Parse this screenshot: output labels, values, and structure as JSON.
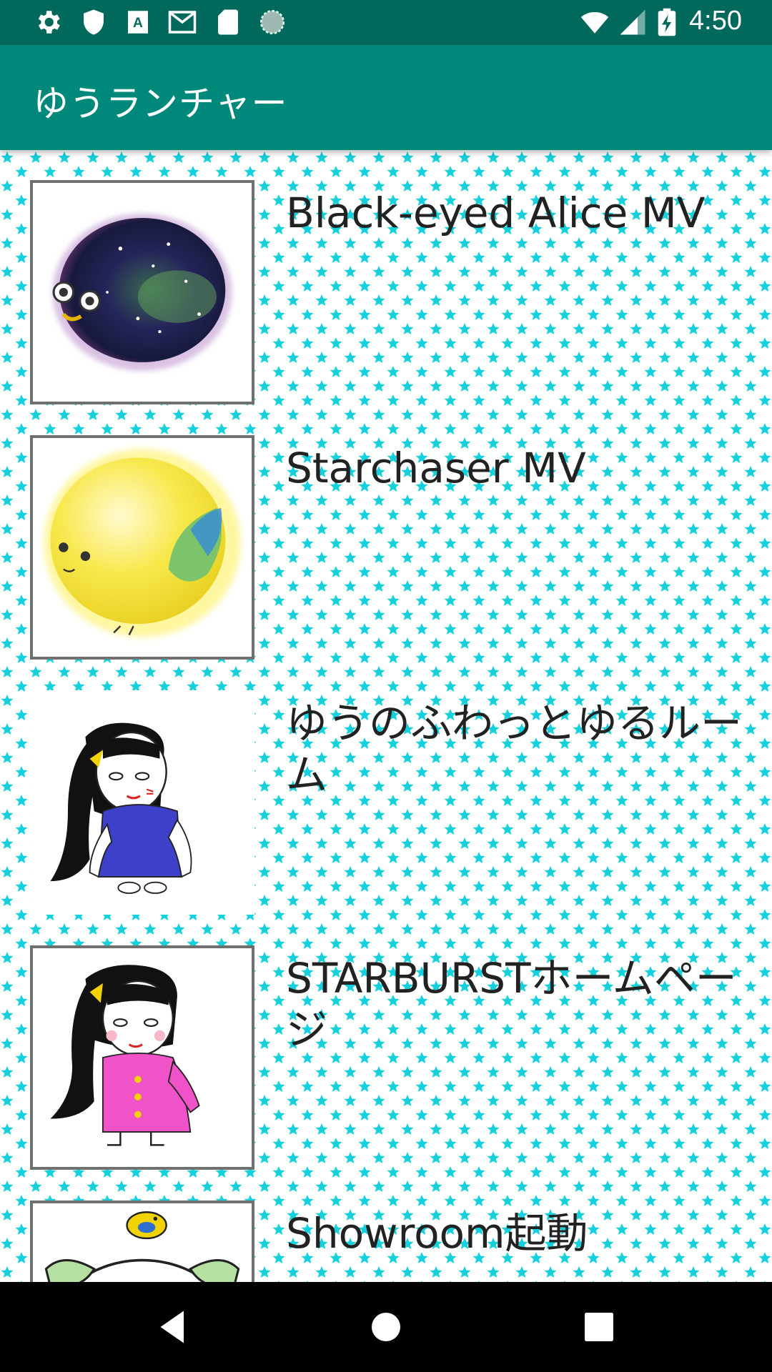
{
  "status_bar": {
    "time": "4:50",
    "icons": [
      "gear-icon",
      "shield-icon",
      "text-a-icon",
      "gmail-icon",
      "sd-card-icon",
      "sync-circle-icon"
    ],
    "right_icons": [
      "wifi-icon",
      "signal-icon",
      "battery-charging-icon"
    ]
  },
  "app_bar": {
    "title": "ゆうランチャー"
  },
  "list": {
    "items": [
      {
        "title": "Black-eyed Alice MV",
        "thumb": "galaxy-blob-creature"
      },
      {
        "title": "Starchaser MV",
        "thumb": "yellow-bird-creature"
      },
      {
        "title": "ゆうのふわっとゆるルーム",
        "thumb": "girl-blue-dress"
      },
      {
        "title": "STARBURSTホームページ",
        "thumb": "girl-pink-coat"
      },
      {
        "title": "Showroom起動",
        "thumb": "sheep-with-bird"
      }
    ]
  },
  "nav_bar": {
    "buttons": [
      "back-icon",
      "home-icon",
      "recents-icon"
    ]
  },
  "colors": {
    "status_bar": "#00695c",
    "app_bar": "#00897b",
    "star_pattern": "#16d0dc"
  }
}
